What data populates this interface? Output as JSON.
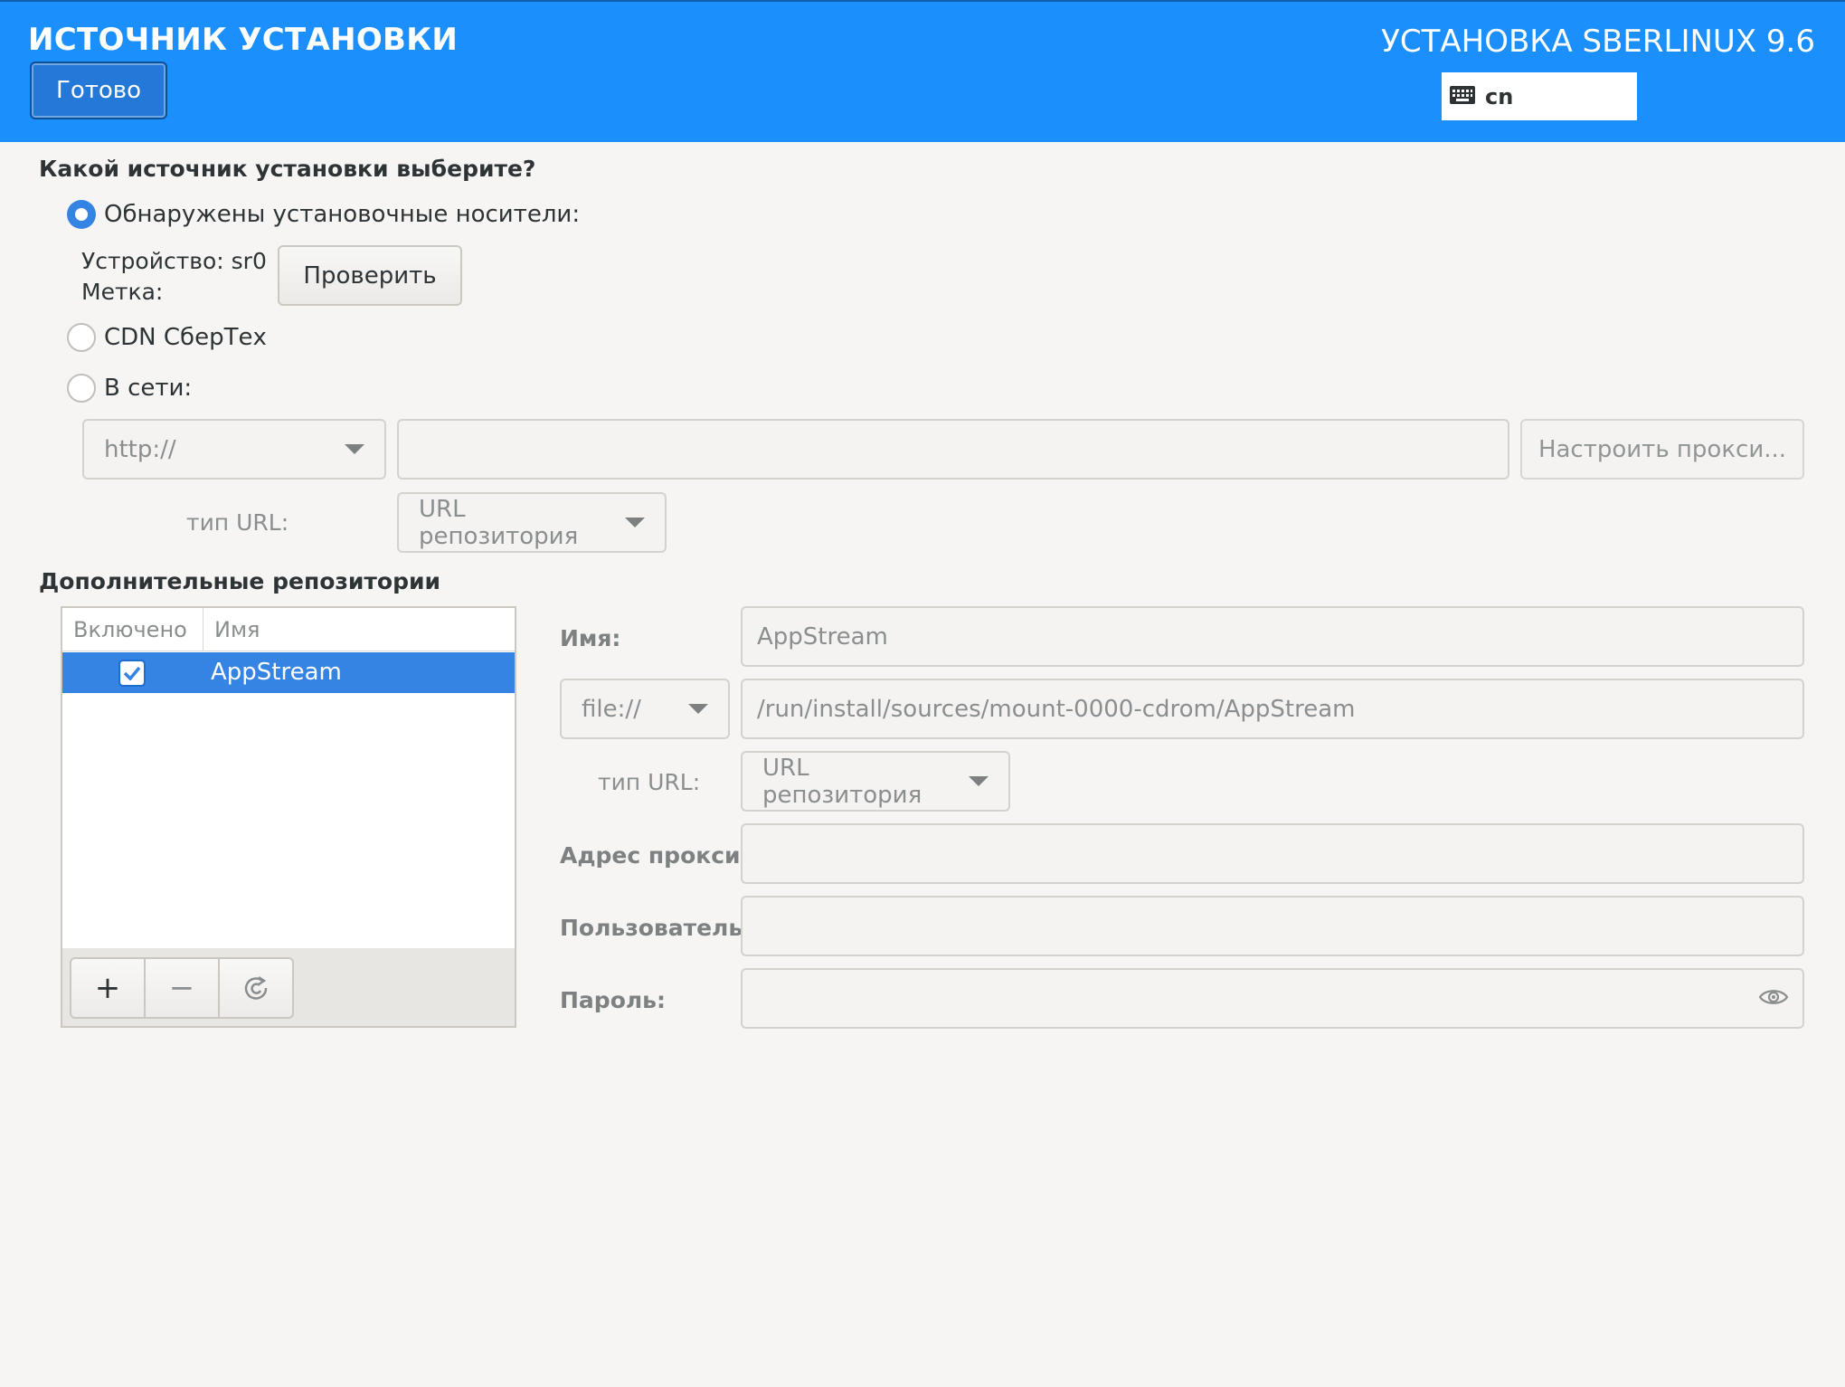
{
  "header": {
    "title": "ИСТОЧНИК УСТАНОВКИ",
    "done_label": "Готово",
    "product": "УСТАНОВКА SBERLINUX 9.6",
    "keyboard_layout": "cn",
    "accent_color": "#1b8ffc"
  },
  "source": {
    "heading": "Какой источник установки выберите?",
    "options": [
      {
        "label": "Обнаружены установочные носители:",
        "selected": true
      },
      {
        "label": "CDN СберТех",
        "selected": false
      },
      {
        "label": "В сети:",
        "selected": false
      }
    ],
    "device_line": "Устройство: sr0",
    "label_line": "Метка:",
    "verify_label": "Проверить",
    "network": {
      "protocol": "http://",
      "url_value": "",
      "proxy_button": "Настроить прокси...",
      "url_type_label": "тип URL:",
      "url_type_value": "URL репозитория"
    }
  },
  "repos": {
    "heading": "Дополнительные репозитории",
    "columns": [
      "Включено",
      "Имя"
    ],
    "rows": [
      {
        "enabled": true,
        "name": "AppStream",
        "selected": true
      }
    ],
    "toolbar": {
      "add": "+",
      "remove": "−",
      "revert_icon": "revert-icon"
    }
  },
  "repo_form": {
    "name_label": "Имя:",
    "name_value": "AppStream",
    "protocol": "file://",
    "path_value": "/run/install/sources/mount-0000-cdrom/AppStream",
    "url_type_label": "тип URL:",
    "url_type_value": "URL репозитория",
    "proxy_label": "Адрес прокси:",
    "proxy_value": "",
    "user_label": "Пользователь:",
    "user_value": "",
    "password_label": "Пароль:",
    "password_value": ""
  }
}
